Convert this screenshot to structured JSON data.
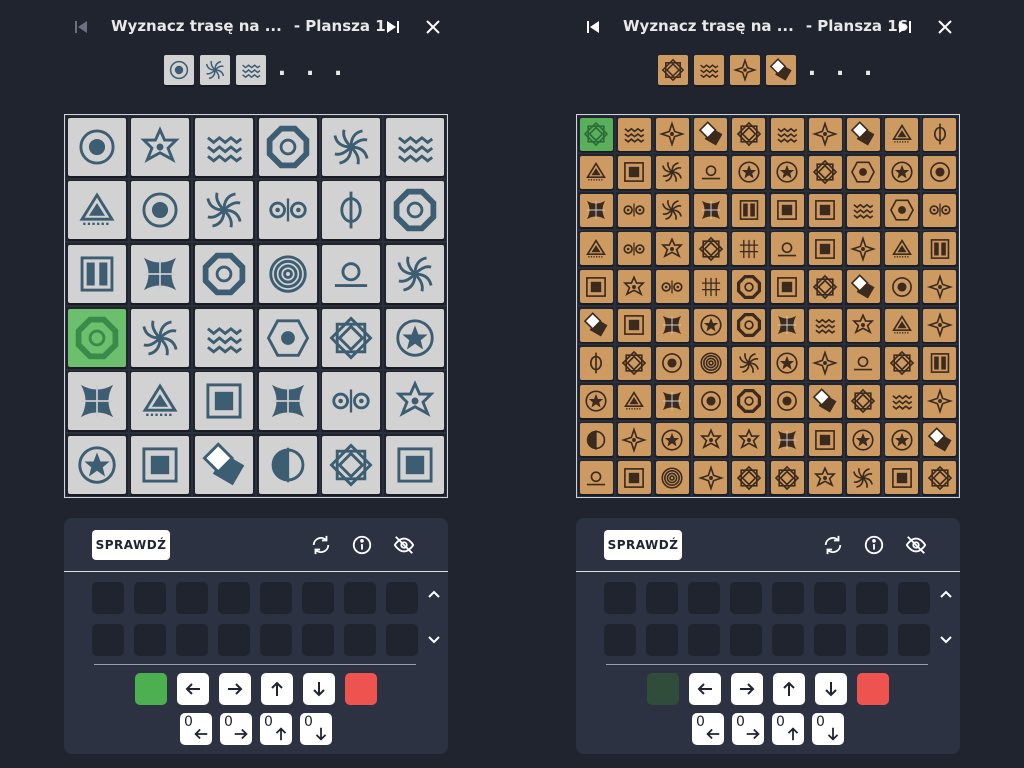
{
  "colors": {
    "bg": "#20242e",
    "panel": "#2c3242",
    "gray_tile": "#d2d2d2",
    "orange_tile": "#cd9a62",
    "symbol": "#3d5e72",
    "orange_symbol": "#3b2a1e",
    "green": "#4caf50",
    "dark_green": "#2f4d3a",
    "red": "#ef5350"
  },
  "left": {
    "title": "Wyznacz trasę na ...",
    "board_label": "- Plansza 1",
    "sequence": [
      "target",
      "spiral",
      "waves"
    ],
    "dots": ". . .",
    "check_label": "SPRAWDŹ",
    "grid": [
      [
        "target",
        "star6",
        "waves",
        "octagon",
        "spiral",
        "waves"
      ],
      [
        "triangle",
        "target",
        "spiral",
        "double",
        "phi",
        "octagon"
      ],
      [
        "bars",
        "cross",
        "octagon",
        "rings",
        "sun",
        "spiral"
      ],
      [
        "octagon",
        "spiral",
        "waves",
        "hexagon",
        "diamond",
        "star"
      ],
      [
        "cross",
        "triangle",
        "square",
        "cross",
        "double",
        "star6"
      ],
      [
        "star",
        "square",
        "flag",
        "half",
        "diamond",
        "square"
      ]
    ],
    "highlight": [
      3,
      0
    ],
    "green_cmd": "active"
  },
  "right": {
    "title": "Wyznacz trasę na ...",
    "board_label": "- Plansza 16",
    "sequence": [
      "diamond",
      "waves",
      "compass",
      "flag"
    ],
    "dots": ". . .",
    "check_label": "SPRAWDŹ",
    "grid": [
      [
        "diamond",
        "waves",
        "compass",
        "flag",
        "diamond",
        "waves",
        "compass",
        "flag",
        "triangle",
        "phi"
      ],
      [
        "triangle",
        "square",
        "spiral",
        "sun",
        "star",
        "star",
        "diamond",
        "hexagon",
        "star"
      ],
      [
        "cross",
        "double",
        "spiral",
        "cross",
        "bars",
        "square",
        "square",
        "waves",
        "hexagon",
        "double"
      ],
      [
        "triangle",
        "double",
        "star6",
        "diamond",
        "lines",
        "sun",
        "square",
        "compass",
        "triangle",
        "bars"
      ],
      [
        "square",
        "star6",
        "double",
        "lines",
        "octagon",
        "square",
        "diamond",
        "flag",
        "target",
        "compass"
      ],
      [
        "flag",
        "square",
        "cross",
        "star",
        "octagon",
        "cross",
        "waves",
        "star6",
        "triangle",
        "compass"
      ],
      [
        "phi",
        "diamond",
        "target",
        "rings",
        "spiral",
        "star",
        "compass",
        "sun",
        "diamond",
        "bars"
      ],
      [
        "star",
        "triangle",
        "cross",
        "target",
        "octagon",
        "target",
        "flag",
        "diamond",
        "waves",
        "compass"
      ],
      [
        "half",
        "compass",
        "star",
        "star6",
        "star6",
        "cross",
        "square",
        "star",
        "star",
        "flag"
      ],
      [
        "sun",
        "square",
        "rings",
        "compass",
        "diamond",
        "diamond",
        "star6",
        "spiral",
        "square",
        "diamond"
      ]
    ],
    "highlight": [
      0,
      0
    ],
    "green_cmd": "inactive"
  }
}
